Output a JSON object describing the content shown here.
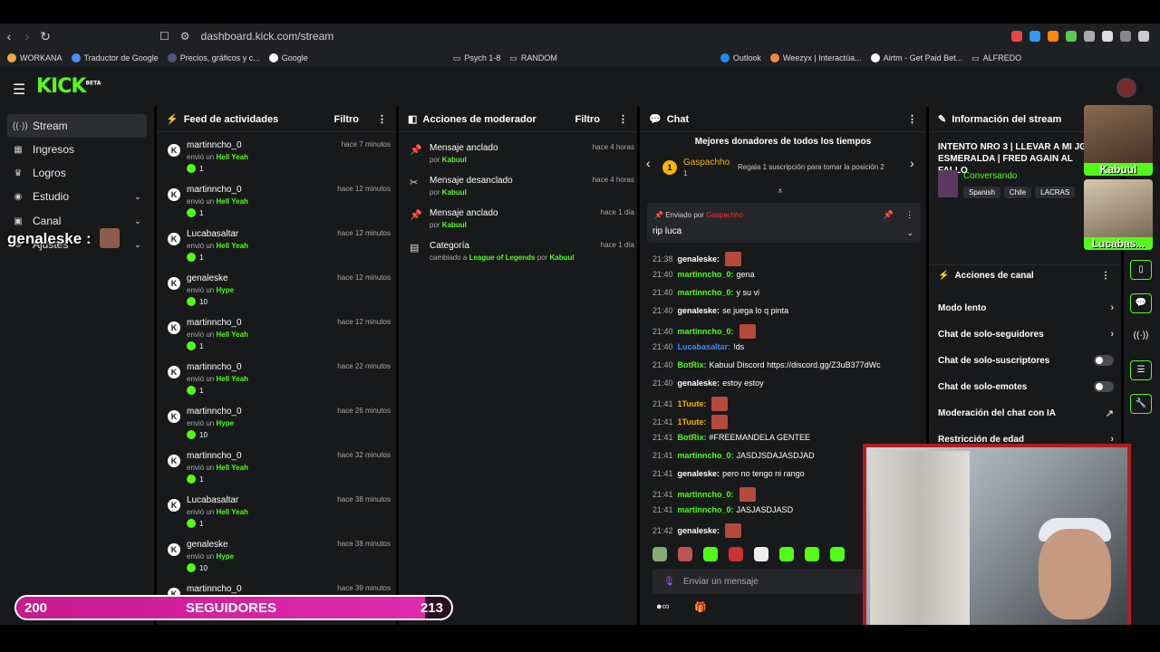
{
  "browser": {
    "url": "dashboard.kick.com/stream",
    "bookmarks": [
      "WORKANA",
      "Traductor de Google",
      "Precios, gráficos y c...",
      "Google",
      "Psych 1-8",
      "RANDOM",
      "Outlook",
      "Weezyx | Interactúa...",
      "Airtm - Get Paid Bet...",
      "ALFREDO"
    ]
  },
  "kick": {
    "logo": "KICK",
    "beta": "BETA"
  },
  "sidebar": {
    "items": [
      {
        "label": "Stream",
        "icon": "broadcast-icon"
      },
      {
        "label": "Ingresos",
        "icon": "chart-icon"
      },
      {
        "label": "Logros",
        "icon": "trophy-icon"
      },
      {
        "label": "Estudio",
        "icon": "studio-icon"
      },
      {
        "label": "Canal",
        "icon": "channel-icon"
      },
      {
        "label": "Ajustes",
        "icon": "settings-icon"
      }
    ],
    "overlay_name": "genaleske :"
  },
  "feed": {
    "title": "Feed de actividades",
    "filter": "Filtro",
    "rows": [
      {
        "name": "martinncho_0",
        "time": "hace 7 minutos",
        "sub_prefix": "envió un",
        "gift": "Hell Yeah",
        "amount": "1"
      },
      {
        "name": "martinncho_0",
        "time": "hace 12 minutos",
        "sub_prefix": "envió un",
        "gift": "Hell Yeah",
        "amount": "1"
      },
      {
        "name": "Lucabasaltar",
        "time": "hace 12 minutos",
        "sub_prefix": "envió un",
        "gift": "Hell Yeah",
        "amount": "1"
      },
      {
        "name": "genaleske",
        "time": "hace 12 minutos",
        "sub_prefix": "envió un",
        "gift": "Hype",
        "amount": "10"
      },
      {
        "name": "martinncho_0",
        "time": "hace 12 minutos",
        "sub_prefix": "envió un",
        "gift": "Hell Yeah",
        "amount": "1"
      },
      {
        "name": "martinncho_0",
        "time": "hace 22 minutos",
        "sub_prefix": "envió un",
        "gift": "Hell Yeah",
        "amount": "1"
      },
      {
        "name": "martinncho_0",
        "time": "hace 26 minutos",
        "sub_prefix": "envió un",
        "gift": "Hype",
        "amount": "10"
      },
      {
        "name": "martinncho_0",
        "time": "hace 32 minutos",
        "sub_prefix": "envió un",
        "gift": "Hell Yeah",
        "amount": "1"
      },
      {
        "name": "Lucabasaltar",
        "time": "hace 38 minutos",
        "sub_prefix": "envió un",
        "gift": "Hell Yeah",
        "amount": "1"
      },
      {
        "name": "genaleske",
        "time": "hace 38 minutos",
        "sub_prefix": "envió un",
        "gift": "Hype",
        "amount": "10"
      },
      {
        "name": "martinncho_0",
        "time": "hace 39 minutos",
        "sub_prefix": "",
        "gift": "",
        "amount": ""
      }
    ]
  },
  "mod": {
    "title": "Acciones de moderador",
    "filter": "Filtro",
    "rows": [
      {
        "title": "Mensaje anclado",
        "time": "hace 4 horas",
        "sub": "por",
        "user": "Kabuul",
        "icon": "pin-icon"
      },
      {
        "title": "Mensaje desanclado",
        "time": "hace 4 horas",
        "sub": "por",
        "user": "Kabuul",
        "icon": "unpin-icon"
      },
      {
        "title": "Mensaje anclado",
        "time": "hace 1 día",
        "sub": "por",
        "user": "Kabuul",
        "icon": "pin-icon"
      },
      {
        "title": "Categoría",
        "time": "hace 1 día",
        "sub": "cambiado a",
        "category": "League of Legends",
        "por": "por",
        "user": "Kabuul",
        "icon": "category-icon"
      }
    ]
  },
  "chat": {
    "title": "Chat",
    "donors_title": "Mejores donadores de todos los tiempos",
    "donor_rank": "1",
    "donor_name": "Gaspachho",
    "donor_count": "1",
    "donor_regala": "Regala 1 suscripción para tomar la posición 2",
    "pinned_by": "Enviado por",
    "pinned_user": "Gaspachho",
    "pinned_msg": "rip luca",
    "lines": [
      {
        "t": "21:38",
        "u": "genaleske:",
        "m": "",
        "color": "#ffffff",
        "emote": true
      },
      {
        "t": "21:40",
        "u": "martinncho_0:",
        "m": "gena",
        "color": "#53fc18",
        "emote": false
      },
      {
        "t": "21:40",
        "u": "martinncho_0:",
        "m": "y su vi",
        "color": "#53fc18",
        "emote": false
      },
      {
        "t": "21:40",
        "u": "genaleske:",
        "m": "se juega lo q pinta",
        "color": "#ffffff",
        "emote": false
      },
      {
        "t": "21:40",
        "u": "martinncho_0:",
        "m": "",
        "color": "#53fc18",
        "emote": true
      },
      {
        "t": "21:40",
        "u": "Lucabasaltar:",
        "m": "!ds",
        "color": "#3b8cff",
        "emote": false
      },
      {
        "t": "21:40",
        "u": "BotRix:",
        "m": "Kabuul Discord https://discord.gg/Z3uB377dWc",
        "color": "#53fc18",
        "emote": false
      },
      {
        "t": "21:40",
        "u": "genaleske:",
        "m": "estoy estoy",
        "color": "#ffffff",
        "emote": false
      },
      {
        "t": "21:41",
        "u": "1Tuute:",
        "m": "",
        "color": "#f5b400",
        "emote": true
      },
      {
        "t": "21:41",
        "u": "1Tuute:",
        "m": "",
        "color": "#f5b400",
        "emote": true
      },
      {
        "t": "21:41",
        "u": "BotRix:",
        "m": "#FREEMANDELA GENTEE",
        "color": "#53fc18",
        "emote": false
      },
      {
        "t": "21:41",
        "u": "martinncho_0:",
        "m": "JASDJSDAJASDJAD",
        "color": "#53fc18",
        "emote": false
      },
      {
        "t": "21:41",
        "u": "genaleske:",
        "m": "pero no tengo ni rango",
        "color": "#ffffff",
        "emote": false
      },
      {
        "t": "21:41",
        "u": "martinncho_0:",
        "m": "",
        "color": "#53fc18",
        "emote": true
      },
      {
        "t": "21:41",
        "u": "martinncho_0:",
        "m": "JASJASDJASD",
        "color": "#53fc18",
        "emote": false
      },
      {
        "t": "21:42",
        "u": "genaleske:",
        "m": "",
        "color": "#ffffff",
        "emote": true
      }
    ],
    "input_placeholder": "Enviar un mensaje"
  },
  "stream_info": {
    "title": "Información del stream",
    "stream_title": "INTENTO NRO 3 | LLEVAR A MI JG A ESMERALDA | FRED AGAIN AL FALLO",
    "category": "Conversando",
    "tags": [
      "Spanish",
      "Chile",
      "LACRAS"
    ]
  },
  "channel_actions": {
    "title": "Acciones de canal",
    "items": [
      {
        "label": "Modo lento",
        "control": "arrow"
      },
      {
        "label": "Chat de solo-seguidores",
        "control": "arrow"
      },
      {
        "label": "Chat de solo-suscriptores",
        "control": "toggle"
      },
      {
        "label": "Chat de solo-emotes",
        "control": "toggle"
      },
      {
        "label": "Moderación del chat con IA",
        "control": "external"
      },
      {
        "label": "Restricción de edad",
        "control": "arrow"
      }
    ]
  },
  "cams": {
    "cam1": "Kabuul",
    "cam2": "Lucabas..."
  },
  "goal": {
    "current": "200",
    "label": "SEGUIDORES",
    "target": "213",
    "progress": 0.94
  }
}
